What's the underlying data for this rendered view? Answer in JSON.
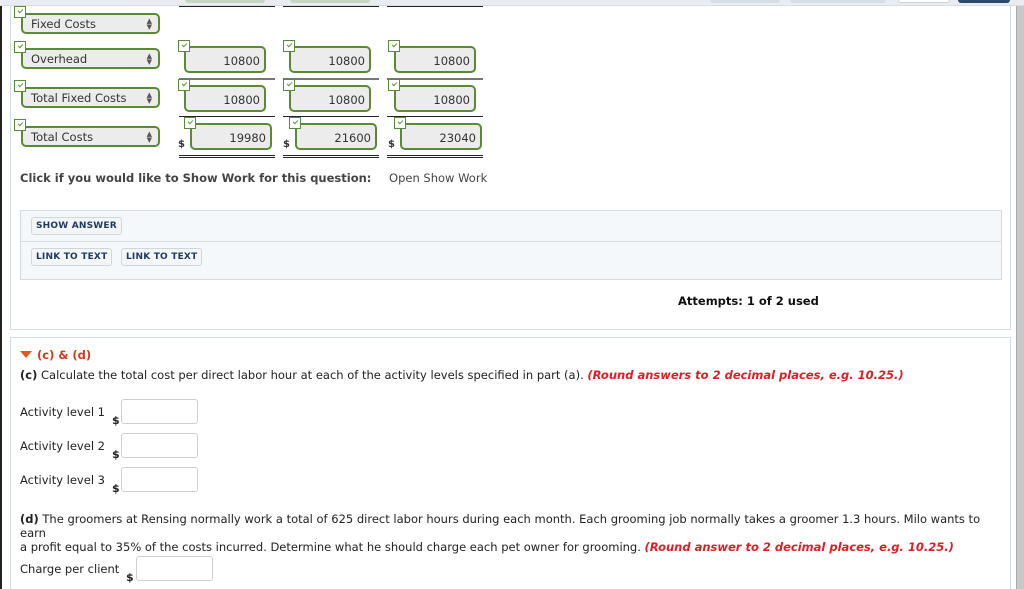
{
  "worksheet": {
    "rows": [
      {
        "label": "Fixed Costs",
        "values": []
      },
      {
        "label": "Overhead",
        "values": [
          "10800",
          "10800",
          "10800"
        ]
      },
      {
        "label": "Total Fixed Costs",
        "values": [
          "10800",
          "10800",
          "10800"
        ]
      },
      {
        "label": "Total Costs",
        "currency": "$",
        "values": [
          "19980",
          "21600",
          "23040"
        ]
      }
    ]
  },
  "show_work": {
    "label": "Click if you would like to Show Work for this question:",
    "link": "Open Show Work"
  },
  "buttons": {
    "show_answer": "SHOW ANSWER",
    "link_to_text_1": "LINK TO TEXT",
    "link_to_text_2": "LINK TO TEXT"
  },
  "attempts": "Attempts: 1 of 2 used",
  "section": {
    "title": "(c) & (d)",
    "part_c": {
      "label": "(c)",
      "text": " Calculate the total cost per direct labor hour at each of the activity levels specified in part (a). ",
      "note": "(Round answers to 2 decimal places, e.g. 10.25.)",
      "inputs": [
        {
          "label": "Activity level 1",
          "currency": "$",
          "value": ""
        },
        {
          "label": "Activity level 2",
          "currency": "$",
          "value": ""
        },
        {
          "label": "Activity level 3",
          "currency": "$",
          "value": ""
        }
      ]
    },
    "part_d": {
      "label": "(d)",
      "text_line1": " The groomers at Rensing normally work a total of 625 direct labor hours during each month. Each grooming job normally takes a groomer 1.3 hours. Milo wants to earn",
      "text_line2": "a profit equal to 35% of the costs incurred. Determine what he should charge each pet owner for grooming. ",
      "note": "(Round answer to 2 decimal places, e.g. 10.25.)",
      "input": {
        "label": "Charge per client",
        "currency": "$",
        "value": ""
      }
    }
  },
  "colors": {
    "accent_green": "#5b8a35",
    "section_title": "#d43a1a",
    "note_red": "#e31b23",
    "button_text": "#1e3a5f"
  }
}
